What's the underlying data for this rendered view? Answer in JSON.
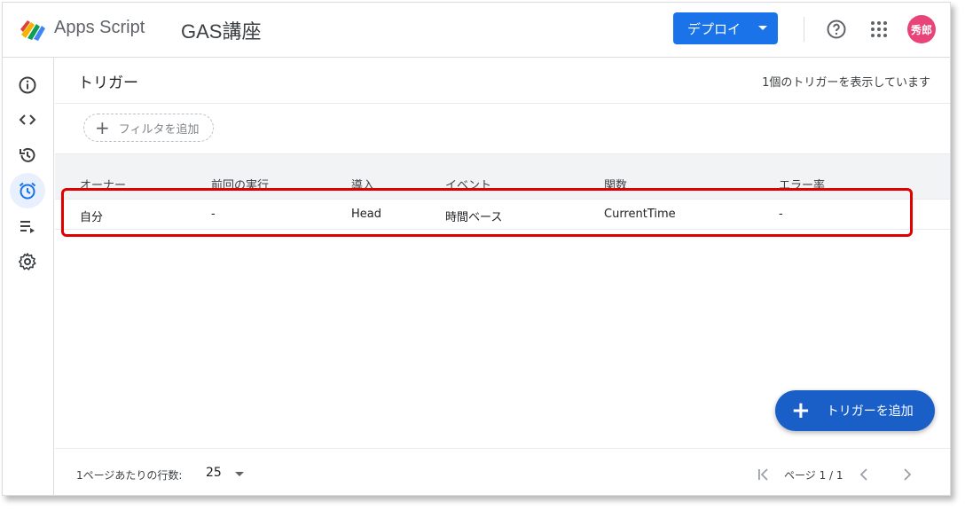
{
  "header": {
    "app_name": "Apps Script",
    "project_name": "GAS講座",
    "deploy_label": "デプロイ",
    "avatar_text": "秀郎"
  },
  "sidebar": {
    "items": [
      {
        "icon": "info-icon"
      },
      {
        "icon": "code-icon"
      },
      {
        "icon": "history-icon"
      },
      {
        "icon": "alarm-icon",
        "active": true
      },
      {
        "icon": "executions-icon"
      },
      {
        "icon": "gear-icon"
      }
    ]
  },
  "page": {
    "title": "トリガー",
    "count_text": "1個のトリガーを表示しています",
    "filter_label": "フィルタを追加"
  },
  "table": {
    "headers": [
      "オーナー",
      "前回の実行",
      "導入",
      "イベント",
      "関数",
      "エラー率"
    ],
    "rows": [
      [
        "自分",
        "-",
        "Head",
        "時間ベース",
        "CurrentTime",
        "-"
      ]
    ]
  },
  "fab": {
    "label": "トリガーを追加"
  },
  "footer": {
    "rows_per_page_label": "1ページあたりの行数:",
    "rows_per_page_value": "25",
    "page_label": "ページ 1 / 1"
  },
  "colors": {
    "accent": "#1a73e8",
    "fab": "#1a5fc8",
    "highlight": "#e00000",
    "avatar": "#e8447a"
  }
}
